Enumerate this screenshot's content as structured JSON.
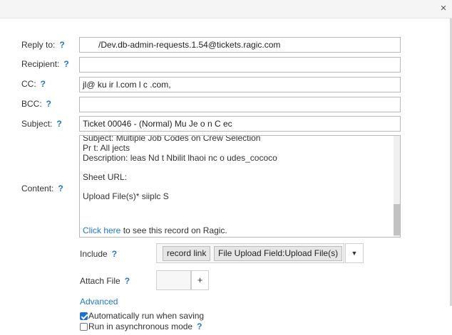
{
  "dialog": {
    "close_glyph": "×"
  },
  "form": {
    "help_glyph": "?",
    "reply_to": {
      "label": "Reply to:",
      "value": "/Dev.db-admin-requests.1.54@tickets.ragic.com"
    },
    "recipient": {
      "label": "Recipient:",
      "value": ""
    },
    "cc": {
      "label": "CC:",
      "value": "jl@ ku      ir     l.com   l       c         .com,"
    },
    "bcc": {
      "label": "BCC:",
      "value": ""
    },
    "subject": {
      "label": "Subject:",
      "value": "Ticket 00046 - (Normal) Mu       Je        o      n  C        ec"
    },
    "content": {
      "label": "Content:",
      "lines": [
        "Subject: Multiple Job Codes on Crew Selection",
        "Pr     t: All    jects",
        "Description:   leas     Nd t   Nbilit    lhaoi  nc       o           udes_cococo",
        "",
        "Sheet URL:",
        "",
        "Upload File(s)*     siiplc        S"
      ],
      "link_text": "Click here",
      "link_suffix": " to see this record on Ragic."
    },
    "include": {
      "label": "Include",
      "chips": [
        "record link",
        "File Upload Field:Upload File(s)"
      ],
      "dropdown_glyph": "▼"
    },
    "attach": {
      "label": "Attach File",
      "plus": "+"
    },
    "advanced_link": "Advanced",
    "auto_run": {
      "label": "Automatically run when saving",
      "checked": true
    },
    "async": {
      "label": "Run in asynchronous mode",
      "checked": false
    }
  }
}
